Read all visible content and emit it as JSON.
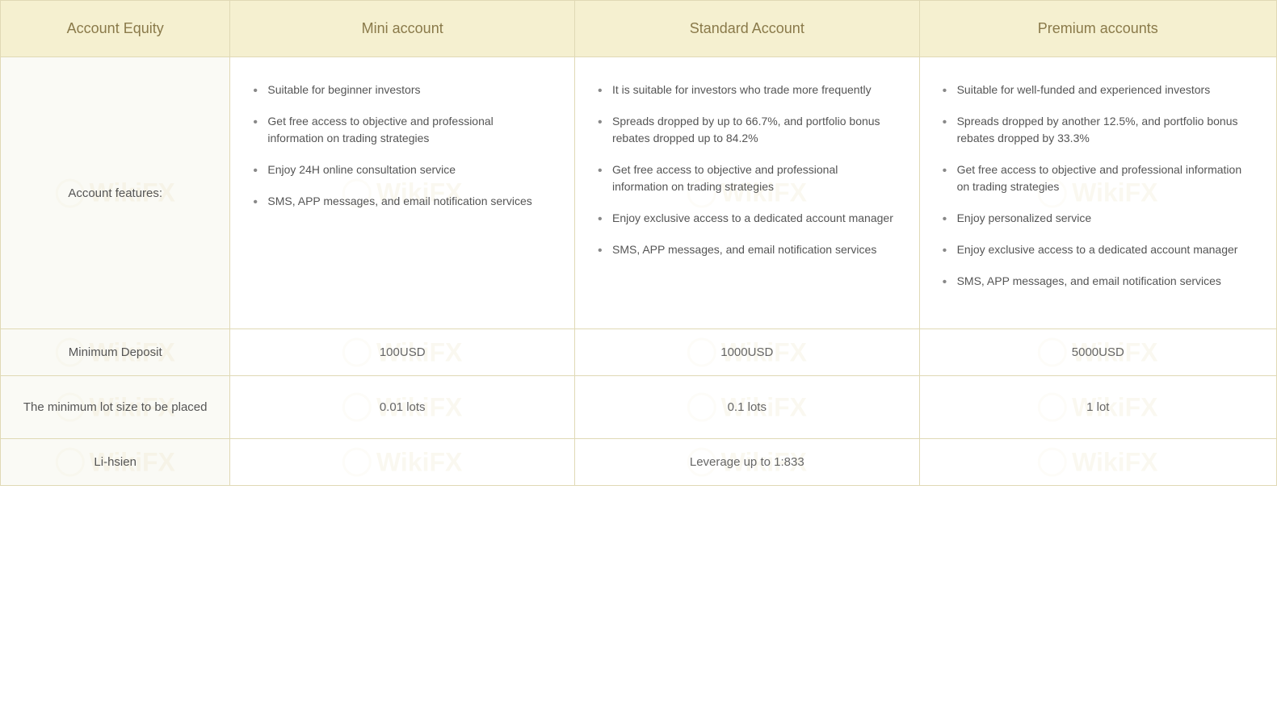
{
  "header": {
    "col_equity": "Account Equity",
    "col_mini": "Mini account",
    "col_standard": "Standard Account",
    "col_premium": "Premium accounts"
  },
  "rows": {
    "features": {
      "label": "Account features:",
      "mini": [
        "Suitable for beginner investors",
        "Get free access to objective and professional information on trading strategies",
        "Enjoy 24H online consultation service",
        "SMS, APP messages, and email notification services"
      ],
      "standard": [
        "It is suitable for investors who trade more frequently",
        "Spreads dropped by up to 66.7%, and portfolio bonus rebates dropped up to 84.2%",
        "Get free access to objective and professional information on trading strategies",
        "Enjoy exclusive access to a dedicated account manager",
        "SMS, APP messages, and email notification services"
      ],
      "premium": [
        "Suitable for well-funded and experienced investors",
        "Spreads dropped by another 12.5%, and portfolio bonus rebates dropped by 33.3%",
        "Get free access to objective and professional information on trading strategies",
        "Enjoy personalized service",
        "Enjoy exclusive access to a dedicated account manager",
        "SMS, APP messages, and email notification services"
      ]
    },
    "min_deposit": {
      "label": "Minimum Deposit",
      "mini": "100USD",
      "standard": "1000USD",
      "premium": "5000USD"
    },
    "min_lot": {
      "label": "The minimum lot size to be placed",
      "mini": "0.01 lots",
      "standard": "0.1 lots",
      "premium": "1 lot"
    },
    "footer": {
      "label": "Li-hsien",
      "standard_note": "Leverage up to 1:833"
    }
  },
  "watermark": {
    "text": "WikiFX"
  }
}
